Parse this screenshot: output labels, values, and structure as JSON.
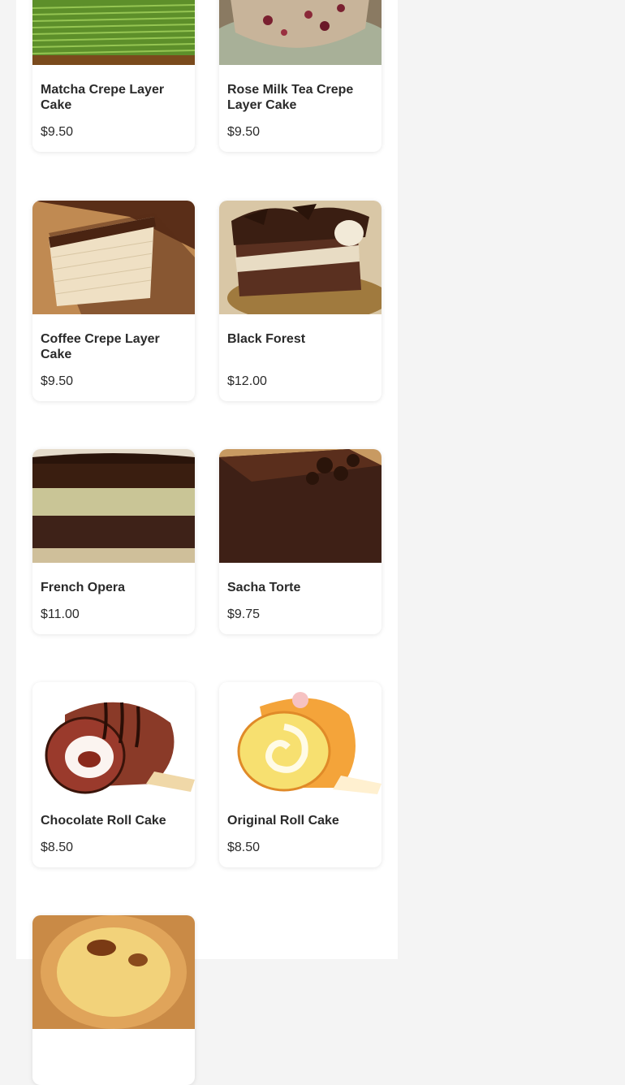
{
  "menu": {
    "items": [
      {
        "name": "Matcha Crepe Layer Cake",
        "price": "$9.50",
        "icon": "matcha-crepe-cake-image"
      },
      {
        "name": "Rose Milk Tea Crepe Layer Cake",
        "price": "$9.50",
        "icon": "rose-milk-tea-crepe-cake-image"
      },
      {
        "name": "Coffee Crepe Layer Cake",
        "price": "$9.50",
        "icon": "coffee-crepe-cake-image"
      },
      {
        "name": "Black Forest",
        "price": "$12.00",
        "icon": "black-forest-cake-image"
      },
      {
        "name": "French Opera",
        "price": "$11.00",
        "icon": "french-opera-cake-image"
      },
      {
        "name": "Sacha Torte",
        "price": "$9.75",
        "icon": "sacha-torte-image"
      },
      {
        "name": "Chocolate Roll Cake",
        "price": "$8.50",
        "icon": "chocolate-roll-cake-image"
      },
      {
        "name": "Original Roll Cake",
        "price": "$8.50",
        "icon": "original-roll-cake-image"
      },
      {
        "name": "",
        "price": "",
        "icon": "egg-tart-image"
      }
    ]
  },
  "colors": {
    "page_background": "#f4f4f4",
    "panel_background": "#ffffff",
    "text": "#2a2a2a"
  }
}
